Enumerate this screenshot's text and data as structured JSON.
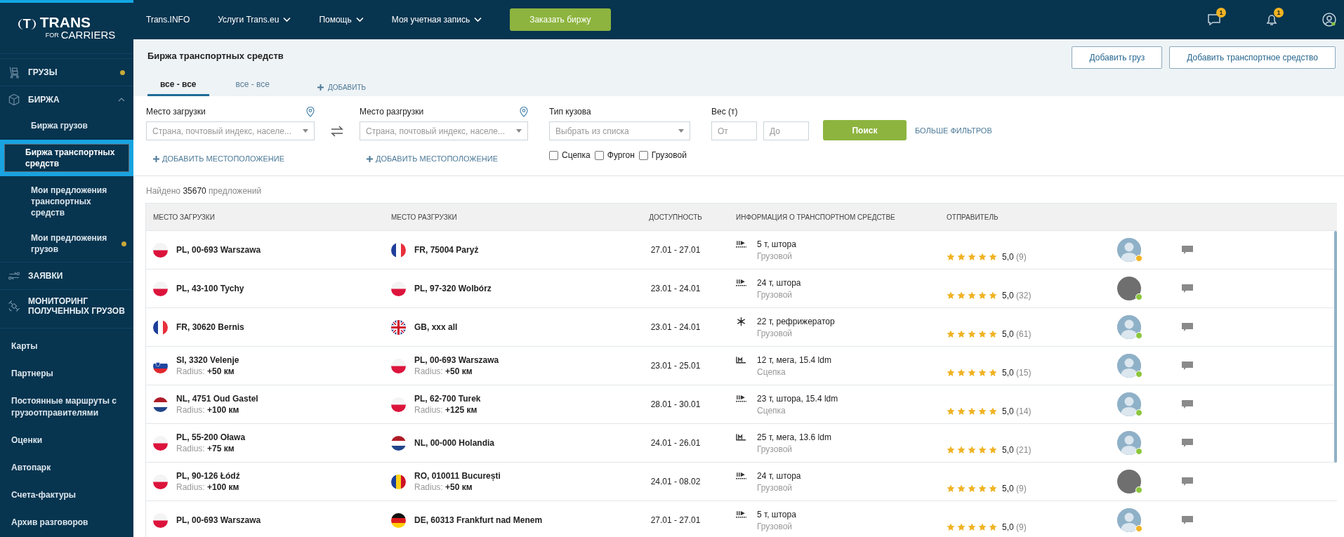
{
  "logo": {
    "mark": "T",
    "name": "TRANS",
    "sub_a": "FOR",
    "sub_b": "CARRIERS"
  },
  "sidebar": {
    "sections": [
      {
        "label": "ГРУЗЫ",
        "kind": "cart",
        "dot": true,
        "expanded": false
      },
      {
        "label": "БИРЖА",
        "kind": "box",
        "dot": false,
        "expanded": true,
        "children": [
          {
            "label": "Биржа грузов",
            "selected": false,
            "dot": false
          },
          {
            "label": "Биржа транспортных средств",
            "selected": true,
            "dot": false
          },
          {
            "label": "Мои предложения транспортных средств",
            "selected": false,
            "dot": false
          },
          {
            "label": "Мои предложения грузов",
            "selected": false,
            "dot": true
          }
        ]
      },
      {
        "label": "ЗАЯВКИ",
        "kind": "swap",
        "dot": false,
        "expanded": false
      },
      {
        "label": "МОНИТОРИНГ ПОЛУЧЕННЫХ ГРУЗОВ",
        "kind": "satellite",
        "dot": false,
        "expanded": false
      }
    ],
    "links": [
      "Карты",
      "Партнеры",
      "Постоянные маршруты с грузоотправителями",
      "Оценки",
      "Автопарк",
      "Счета-фактуры",
      "Архив разговоров"
    ]
  },
  "topnav": {
    "items": [
      {
        "label": "Trans.INFO",
        "dropdown": false
      },
      {
        "label": "Услуги Trans.eu",
        "dropdown": true
      },
      {
        "label": "Помощь",
        "dropdown": true
      },
      {
        "label": "Моя учетная запись",
        "dropdown": true
      }
    ],
    "order_button": "Заказать биржу",
    "messages_badge": "1",
    "notifications_badge": "1"
  },
  "page": {
    "title": "Биржа транспортных средств",
    "buttons": [
      "Добавить груз",
      "Добавить транспортное средство"
    ],
    "tabs": [
      {
        "label": "все - все",
        "selected": true
      },
      {
        "label": "все - все",
        "selected": false
      }
    ],
    "add_tab": "ДОБАВИТЬ"
  },
  "filters": {
    "loading": {
      "label": "Место загрузки",
      "placeholder": "Страна, почтовый индекс, населе...",
      "add": "ДОБАВИТЬ МЕСТОПОЛОЖЕНИЕ"
    },
    "unloading": {
      "label": "Место разгрузки",
      "placeholder": "Страна, почтовый индекс, населе...",
      "add": "ДОБАВИТЬ МЕСТОПОЛОЖЕНИЕ"
    },
    "body_type": {
      "label": "Тип кузова",
      "placeholder": "Выбрать из списка",
      "options": [
        {
          "label": "Сцепка",
          "checked": false
        },
        {
          "label": "Фургон",
          "checked": false
        },
        {
          "label": "Грузовой",
          "checked": false
        }
      ]
    },
    "weight": {
      "label": "Вес (т)",
      "from": {
        "placeholder": "От"
      },
      "to": {
        "placeholder": "До"
      }
    },
    "search_button": "Поиск",
    "more_filters": "БОЛЬШЕ ФИЛЬТРОВ"
  },
  "results": {
    "prefix": "Найдено",
    "count": "35670",
    "suffix": "предложений"
  },
  "table": {
    "columns": [
      "МЕСТО ЗАГРУЗКИ",
      "МЕСТО РАЗГРУЗКИ",
      "ДОСТУПНОСТЬ",
      "ИНФОРМАЦИЯ О ТРАНСПОРТНОМ СРЕДСТВЕ",
      "ОТПРАВИТЕЛЬ"
    ],
    "rows": [
      {
        "from": {
          "kind": "pl",
          "place": "PL, 00-693 Warszawa"
        },
        "to": {
          "kind": "fr",
          "place": "FR, 75004 Paryż"
        },
        "dates": "27.01 - 27.01",
        "vehicle": {
          "kind": "curtain",
          "spec": "5 т, штора",
          "type": "Грузовой"
        },
        "stars": 5,
        "rating": "5,0",
        "reviews": "(9)",
        "avatar": {
          "kind": "silhouette",
          "color": "#f0b323"
        }
      },
      {
        "from": {
          "kind": "pl",
          "place": "PL, 43-100 Tychy"
        },
        "to": {
          "kind": "pl",
          "place": "PL, 97-320 Wolbórz"
        },
        "dates": "23.01 - 24.01",
        "vehicle": {
          "kind": "curtain",
          "spec": "24 т, штора",
          "type": "Грузовой"
        },
        "stars": 5,
        "rating": "5,0",
        "reviews": "(32)",
        "avatar": {
          "kind": "photo",
          "color": "#8dc63f"
        }
      },
      {
        "from": {
          "kind": "fr",
          "place": "FR, 30620 Bernis"
        },
        "to": {
          "kind": "gb",
          "place": "GB, xxx all"
        },
        "dates": "23.01 - 24.01",
        "vehicle": {
          "kind": "reefer",
          "spec": "22 т, рефрижератор",
          "type": "Грузовой"
        },
        "stars": 5,
        "rating": "5,0",
        "reviews": "(61)",
        "avatar": {
          "kind": "silhouette",
          "color": "#8dc63f"
        }
      },
      {
        "from": {
          "kind": "si",
          "place": "SI, 3320 Velenje",
          "radius_label": "Radius:",
          "radius": "+50 км"
        },
        "to": {
          "kind": "pl",
          "place": "PL, 00-693 Warszawa",
          "radius_label": "Radius:",
          "radius": "+50 км"
        },
        "dates": "23.01 - 25.01",
        "vehicle": {
          "kind": "mega",
          "spec": "12 т, мега, 15.4 ldm",
          "type": "Сцепка"
        },
        "stars": 5,
        "rating": "5,0",
        "reviews": "(15)",
        "avatar": {
          "kind": "silhouette",
          "color": "#8dc63f"
        }
      },
      {
        "from": {
          "kind": "nl",
          "place": "NL, 4751 Oud Gastel",
          "radius_label": "Radius:",
          "radius": "+100 км"
        },
        "to": {
          "kind": "pl",
          "place": "PL, 62-700 Turek",
          "radius_label": "Radius:",
          "radius": "+125 км"
        },
        "dates": "28.01 - 30.01",
        "vehicle": {
          "kind": "curtain",
          "spec": "23 т, штора, 15.4 ldm",
          "type": "Сцепка"
        },
        "stars": 5,
        "rating": "5,0",
        "reviews": "(14)",
        "avatar": {
          "kind": "silhouette",
          "color": "#8dc63f"
        }
      },
      {
        "from": {
          "kind": "pl",
          "place": "PL, 55-200 Oława",
          "radius_label": "Radius:",
          "radius": "+75 км"
        },
        "to": {
          "kind": "nl",
          "place": "NL, 00-000 Holandia"
        },
        "dates": "24.01 - 26.01",
        "vehicle": {
          "kind": "mega",
          "spec": "25 т, мега, 13.6 ldm",
          "type": "Грузовой"
        },
        "stars": 5,
        "rating": "5,0",
        "reviews": "(21)",
        "avatar": {
          "kind": "silhouette",
          "color": "#8dc63f"
        }
      },
      {
        "from": {
          "kind": "pl",
          "place": "PL, 90-126 Łódź",
          "radius_label": "Radius:",
          "radius": "+100 км"
        },
        "to": {
          "kind": "ro",
          "place": "RO, 010011 București",
          "radius_label": "Radius:",
          "radius": "+50 км"
        },
        "dates": "24.01 - 08.02",
        "vehicle": {
          "kind": "curtain",
          "spec": "24 т, штора",
          "type": "Грузовой"
        },
        "stars": 5,
        "rating": "5,0",
        "reviews": "(9)",
        "avatar": {
          "kind": "photo",
          "color": "#8dc63f"
        }
      },
      {
        "from": {
          "kind": "pl",
          "place": "PL, 00-693 Warszawa"
        },
        "to": {
          "kind": "de",
          "place": "DE, 60313 Frankfurt nad Menem"
        },
        "dates": "27.01 - 27.01",
        "vehicle": {
          "kind": "curtain",
          "spec": "5 т, штора",
          "type": "Грузовой"
        },
        "stars": 5,
        "rating": "5,0",
        "reviews": "(9)",
        "avatar": {
          "kind": "silhouette",
          "color": "#f0b323"
        }
      }
    ]
  }
}
